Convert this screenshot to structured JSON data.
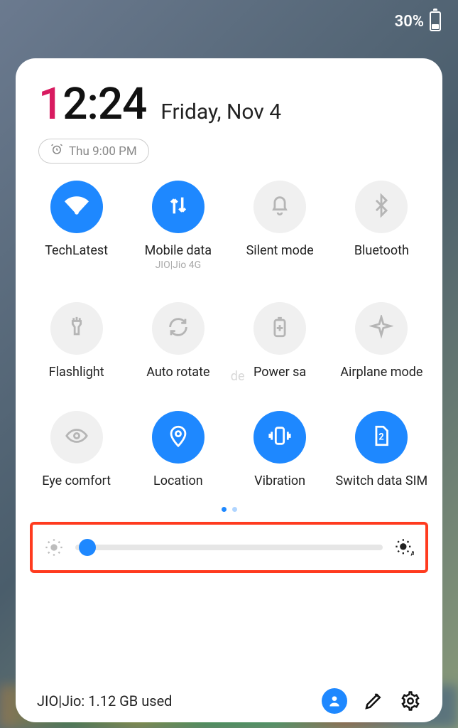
{
  "status": {
    "battery_pct": "30%"
  },
  "clock": {
    "first_digit": "1",
    "rest": "2:24"
  },
  "date": "Friday, Nov 4",
  "alarm": "Thu 9:00 PM",
  "tiles": [
    {
      "label": "TechLatest",
      "sub": "",
      "active": true
    },
    {
      "label": "Mobile data",
      "sub": "JIO|Jio 4G",
      "active": true
    },
    {
      "label": "Silent mode",
      "sub": "",
      "active": false
    },
    {
      "label": "Bluetooth",
      "sub": "",
      "active": false
    },
    {
      "label": "Flashlight",
      "sub": "",
      "active": false
    },
    {
      "label": "Auto rotate",
      "sub": "",
      "active": false
    },
    {
      "label": "Power sa",
      "sub": "",
      "active": false
    },
    {
      "label": "Airplane mode",
      "sub": "",
      "active": false
    },
    {
      "label": "Eye comfort",
      "sub": "",
      "active": false
    },
    {
      "label": "Location",
      "sub": "",
      "active": true
    },
    {
      "label": "Vibration",
      "sub": "",
      "active": true
    },
    {
      "label": "Switch data SIM",
      "sub": "",
      "active": true
    }
  ],
  "ghost_text": "de",
  "brightness_pct": 4,
  "footer_text": "JIO|Jio: 1.12 GB used",
  "colors": {
    "accent": "#1e88ff",
    "highlight_box": "#ff3b1f",
    "clock_accent": "#d81b60"
  }
}
